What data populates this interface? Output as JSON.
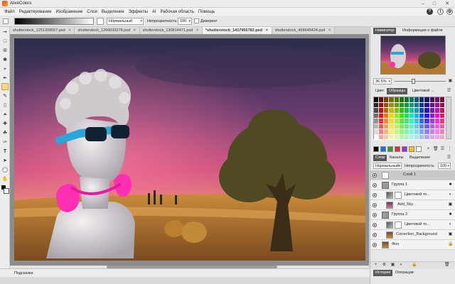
{
  "app": {
    "title": "AliveColors"
  },
  "menu": [
    "Файл",
    "Редактирование",
    "Изображение",
    "Слои",
    "Выделение",
    "Эффекты",
    "AI",
    "Рабочая область",
    "Помощь"
  ],
  "options": {
    "mode": "Нормальный",
    "opacity_label": "Непрозрачность",
    "opacity": "100",
    "dither_label": "Дизеринг"
  },
  "tabs": [
    {
      "label": "shutterstock_1251209557.psd",
      "active": false
    },
    {
      "label": "shutterstock_1266033278.psd",
      "active": false
    },
    {
      "label": "shutterstock_130814471.psd",
      "active": false
    },
    {
      "label": "*shutterstock_1417955782.psd",
      "active": true
    },
    {
      "label": "shutterstock_459645424.psd",
      "active": false
    }
  ],
  "status": {
    "hint": "Подсказка"
  },
  "panels": {
    "navigator_tab": "Навигатор",
    "info_tab": "Информация о файле",
    "zoom": "36.5%",
    "color_tabs": [
      "Цвет",
      "Образцы",
      "Цветовой ..."
    ],
    "layer_tabs": [
      "Слои",
      "Каналы",
      "Выделение"
    ],
    "layer_mode": "Нормальный",
    "layer_opacity_label": "Непрозрачность",
    "layer_opacity": "100",
    "bottom_tabs": [
      "История",
      "Операции"
    ]
  },
  "layers": [
    {
      "name": "Слой 1",
      "selected": true,
      "thumb": "#ffffff"
    },
    {
      "name": "Группа 1",
      "selected": false,
      "thumb": "folder"
    },
    {
      "name": "Цветовой то...",
      "selected": false,
      "thumb": "adjust"
    },
    {
      "name": "Add_Sky",
      "selected": false,
      "thumb": "sky"
    },
    {
      "name": "Группа 2",
      "selected": false,
      "thumb": "folder"
    },
    {
      "name": "Цветовой то...",
      "selected": false,
      "thumb": "adjust"
    },
    {
      "name": "Correction_Background",
      "selected": false,
      "thumb": "bg"
    },
    {
      "name": "Фон",
      "selected": false,
      "thumb": "bg"
    }
  ],
  "swatches": [
    "#000000",
    "#1f6fd6",
    "#3a9a3a",
    "#e03030",
    "#9a30c8",
    "#f2c21a",
    "#ffffff"
  ],
  "colors": {
    "accent": "#f7d88a",
    "selection": "#c9c9c9"
  }
}
